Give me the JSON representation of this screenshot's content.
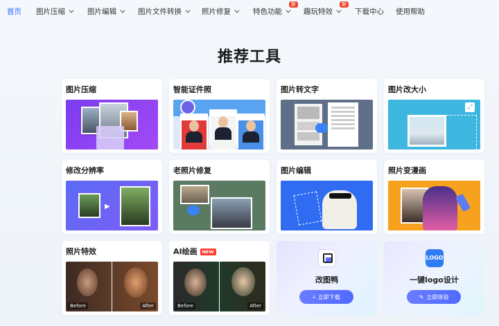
{
  "nav": {
    "items": [
      {
        "label": "首页"
      },
      {
        "label": "图片压缩"
      },
      {
        "label": "图片编辑"
      },
      {
        "label": "图片文件转换"
      },
      {
        "label": "照片修复"
      },
      {
        "label": "特色功能"
      },
      {
        "label": "趣玩特效"
      },
      {
        "label": "下载中心"
      },
      {
        "label": "使用帮助"
      }
    ],
    "new_badge": "新"
  },
  "page_title": "推荐工具",
  "tools": [
    {
      "title": "图片压缩"
    },
    {
      "title": "智能证件照"
    },
    {
      "title": "图片转文字"
    },
    {
      "title": "图片改大小"
    },
    {
      "title": "修改分辨率"
    },
    {
      "title": "老照片修复"
    },
    {
      "title": "图片编辑"
    },
    {
      "title": "照片变漫画"
    },
    {
      "title": "照片特效"
    },
    {
      "title": "AI绘画",
      "badge": "NEW"
    }
  ],
  "before_after": {
    "before": "Before",
    "after": "After"
  },
  "promos": [
    {
      "name": "改图鸭",
      "button": "立即下载",
      "icon": "download-icon"
    },
    {
      "name": "一键logo设计",
      "button": "立即体验",
      "icon": "pen-icon"
    }
  ],
  "colors": {
    "accent": "#2f6bff",
    "badge": "#f0432e"
  }
}
